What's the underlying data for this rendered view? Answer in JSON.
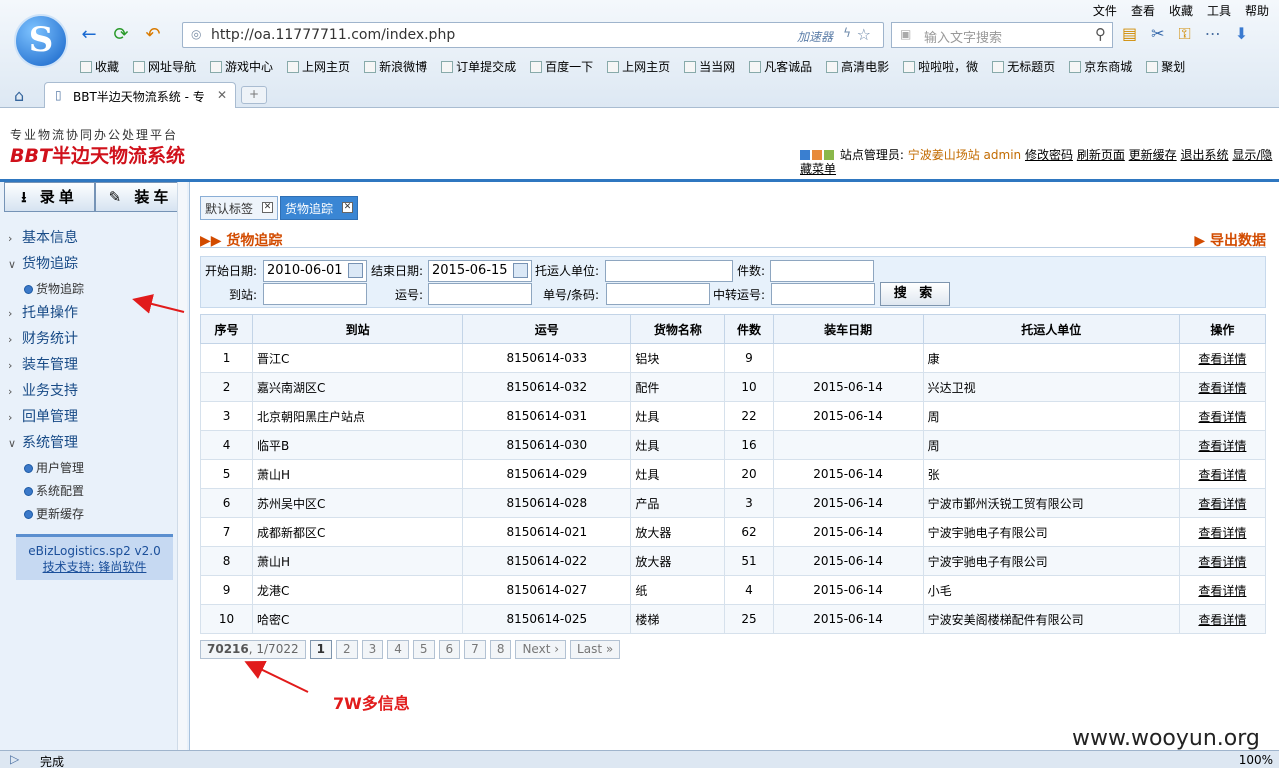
{
  "browser": {
    "menu": [
      "文件",
      "查看",
      "收藏",
      "工具",
      "帮助"
    ],
    "url": "http://oa.11777711.com/index.php",
    "accelerator": "加速器",
    "search_placeholder": "输入文字搜索",
    "bookmarks": [
      "收藏",
      "网址导航",
      "游戏中心",
      "上网主页",
      "新浪微博",
      "订单提交成",
      "百度一下",
      "上网主页",
      "当当网",
      "凡客诚品",
      "高清电影",
      "啦啦啦，微",
      "无标题页",
      "京东商城",
      "聚划"
    ],
    "tab_title": "BBT半边天物流系统 - 专",
    "status": "完成",
    "zoom": "100%"
  },
  "header": {
    "slogan": "专业物流协同办公处理平台",
    "brand_latin": "BBT",
    "brand_cn": "半边天物流系统",
    "role_label": "站点管理员:",
    "station": "宁波姜山场站",
    "user": "admin",
    "links": [
      "修改密码",
      "刷新页面",
      "更新缓存",
      "退出系统",
      "显示/隐藏菜单"
    ],
    "colors": {
      "accent": "#2f77c0",
      "brand": "#d0111b"
    }
  },
  "sidebar": {
    "buttons": [
      "录单",
      "装车"
    ],
    "menu": [
      {
        "label": "基本信息",
        "open": false,
        "children": []
      },
      {
        "label": "货物追踪",
        "open": true,
        "children": [
          "货物追踪"
        ]
      },
      {
        "label": "托单操作",
        "open": false,
        "children": []
      },
      {
        "label": "财务统计",
        "open": false,
        "children": []
      },
      {
        "label": "装车管理",
        "open": false,
        "children": []
      },
      {
        "label": "业务支持",
        "open": false,
        "children": []
      },
      {
        "label": "回单管理",
        "open": false,
        "children": []
      },
      {
        "label": "系统管理",
        "open": true,
        "children": [
          "用户管理",
          "系统配置",
          "更新缓存"
        ]
      }
    ],
    "version": "eBizLogistics.sp2 v2.0",
    "support": "技术支持: 锋尚软件"
  },
  "content": {
    "tabs": [
      {
        "label": "默认标签",
        "active": false
      },
      {
        "label": "货物追踪",
        "active": true
      }
    ],
    "title": "货物追踪",
    "export": "导出数据",
    "filter": {
      "start_label": "开始日期:",
      "start_value": "2010-06-01",
      "end_label": "结束日期:",
      "end_value": "2015-06-15",
      "shipper_label": "托运人单位:",
      "pieces_label": "件数:",
      "dest_label": "到站:",
      "waybill_label": "运号:",
      "barcode_label": "单号/条码:",
      "transfer_label": "中转运号:",
      "search_button": "搜 索"
    },
    "columns": [
      "序号",
      "到站",
      "运号",
      "货物名称",
      "件数",
      "装车日期",
      "托运人单位",
      "操作"
    ],
    "rows": [
      [
        "1",
        "晋江C",
        "8150614-033",
        "铝块",
        "9",
        "",
        "康",
        "查看详情"
      ],
      [
        "2",
        "嘉兴南湖区C",
        "8150614-032",
        "配件",
        "10",
        "2015-06-14",
        "兴达卫视",
        "查看详情"
      ],
      [
        "3",
        "北京朝阳黑庄户站点",
        "8150614-031",
        "灶具",
        "22",
        "2015-06-14",
        "周",
        "查看详情"
      ],
      [
        "4",
        "临平B",
        "8150614-030",
        "灶具",
        "16",
        "",
        "周",
        "查看详情"
      ],
      [
        "5",
        "萧山H",
        "8150614-029",
        "灶具",
        "20",
        "2015-06-14",
        "张",
        "查看详情"
      ],
      [
        "6",
        "苏州吴中区C",
        "8150614-028",
        "产品",
        "3",
        "2015-06-14",
        "宁波市鄞州沃锐工贸有限公司",
        "查看详情"
      ],
      [
        "7",
        "成都新都区C",
        "8150614-021",
        "放大器",
        "62",
        "2015-06-14",
        "宁波宇驰电子有限公司",
        "查看详情"
      ],
      [
        "8",
        "萧山H",
        "8150614-022",
        "放大器",
        "51",
        "2015-06-14",
        "宁波宇驰电子有限公司",
        "查看详情"
      ],
      [
        "9",
        "龙港C",
        "8150614-027",
        "纸",
        "4",
        "2015-06-14",
        "小毛",
        "查看详情"
      ],
      [
        "10",
        "哈密C",
        "8150614-025",
        "楼梯",
        "25",
        "2015-06-14",
        "宁波安美阁楼梯配件有限公司",
        "查看详情"
      ]
    ],
    "pager": {
      "total": "70216",
      "pages": ", 1/7022",
      "items": [
        "1",
        "2",
        "3",
        "4",
        "5",
        "6",
        "7",
        "8",
        "Next ›",
        "Last »"
      ]
    }
  },
  "annotation": {
    "note": "7W多信息",
    "watermark": "www.wooyun.org"
  }
}
